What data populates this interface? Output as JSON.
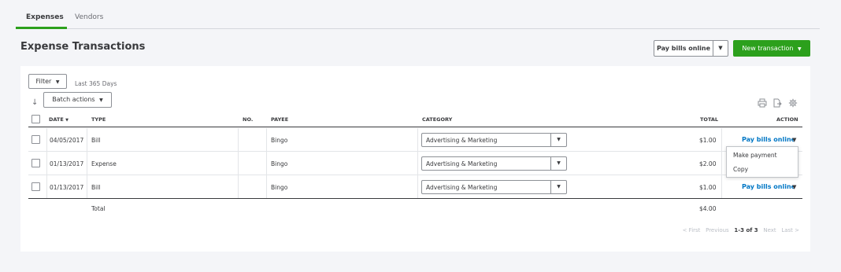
{
  "tabs": [
    {
      "label": "Expenses",
      "active": true
    },
    {
      "label": "Vendors",
      "active": false
    }
  ],
  "page_title": "Expense Transactions",
  "header_buttons": {
    "pay_bills_online": "Pay bills online",
    "new_transaction": "New transaction"
  },
  "toolbar": {
    "filter": "Filter",
    "date_range": "Last 365 Days",
    "batch_actions": "Batch actions"
  },
  "table": {
    "columns": {
      "date": "DATE",
      "type": "TYPE",
      "no": "NO.",
      "payee": "PAYEE",
      "category": "CATEGORY",
      "total": "TOTAL",
      "action": "ACTION"
    },
    "rows": [
      {
        "date": "04/05/2017",
        "type": "Bill",
        "no": "",
        "payee": "Bingo",
        "category": "Advertising & Marketing",
        "total": "$1.00",
        "action": "Pay bills online"
      },
      {
        "date": "01/13/2017",
        "type": "Expense",
        "no": "",
        "payee": "Bingo",
        "category": "Advertising & Marketing",
        "total": "$2.00",
        "action": ""
      },
      {
        "date": "01/13/2017",
        "type": "Bill",
        "no": "",
        "payee": "Bingo",
        "category": "Advertising & Marketing",
        "total": "$1.00",
        "action": "Pay bills online"
      }
    ],
    "total_label": "Total",
    "total_value": "$4.00"
  },
  "action_menu": {
    "items": [
      "Make payment",
      "Copy"
    ]
  },
  "pagination": {
    "first": "< First",
    "previous": "Previous",
    "range": "1-3 of 3",
    "next": "Next",
    "last": "Last >"
  },
  "icons": [
    "print-icon",
    "export-icon",
    "settings-gear-icon",
    "sort-arrow-icon",
    "dropdown-caret-icon"
  ],
  "colors": {
    "accent_green": "#2ca01c",
    "link_blue": "#0077c5",
    "text": "#393a3d"
  }
}
